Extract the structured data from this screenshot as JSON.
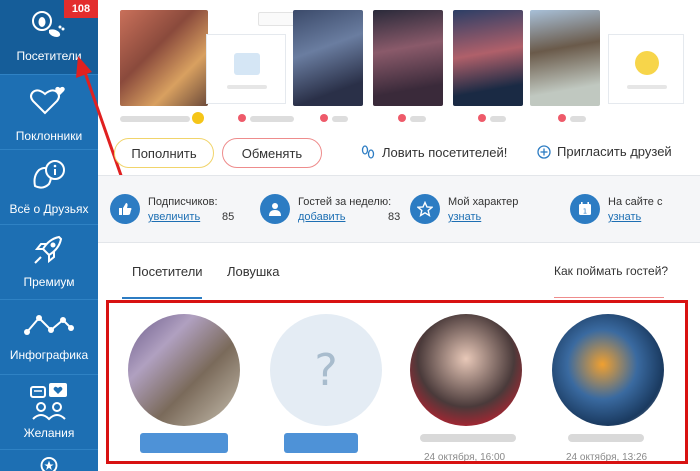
{
  "sidebar": {
    "badge": "108",
    "items": [
      {
        "label": "Посетители"
      },
      {
        "label": "Поклонники"
      },
      {
        "label": "Всё о Друзьях"
      },
      {
        "label": "Премиум"
      },
      {
        "label": "Инфографика"
      },
      {
        "label": "Желания"
      }
    ]
  },
  "actions": {
    "topup": "Пополнить",
    "exchange": "Обменять",
    "catch_visitors": "Ловить посетителей!",
    "invite_friends": "Пригласить друзей"
  },
  "stats": [
    {
      "title": "Подписчиков:",
      "link": "увеличить",
      "count": "85"
    },
    {
      "title": "Гостей за неделю:",
      "link": "добавить",
      "count": "83"
    },
    {
      "title": "Мой характер",
      "link": "узнать"
    },
    {
      "title": "На сайте с",
      "link": "узнать"
    }
  ],
  "tabs": {
    "visitors": "Посетители",
    "trap": "Ловушка",
    "how_to_catch": "Как поймать гостей?"
  },
  "visitors": {
    "placeholder_symbol": "?",
    "dates": [
      "24 октября, 16:00",
      "24 октября, 13:26"
    ]
  },
  "colors": {
    "sidebar": "#1d6fb3",
    "badge": "#e32d2d",
    "accent": "#2c7cc3",
    "highlight": "#d81212"
  }
}
